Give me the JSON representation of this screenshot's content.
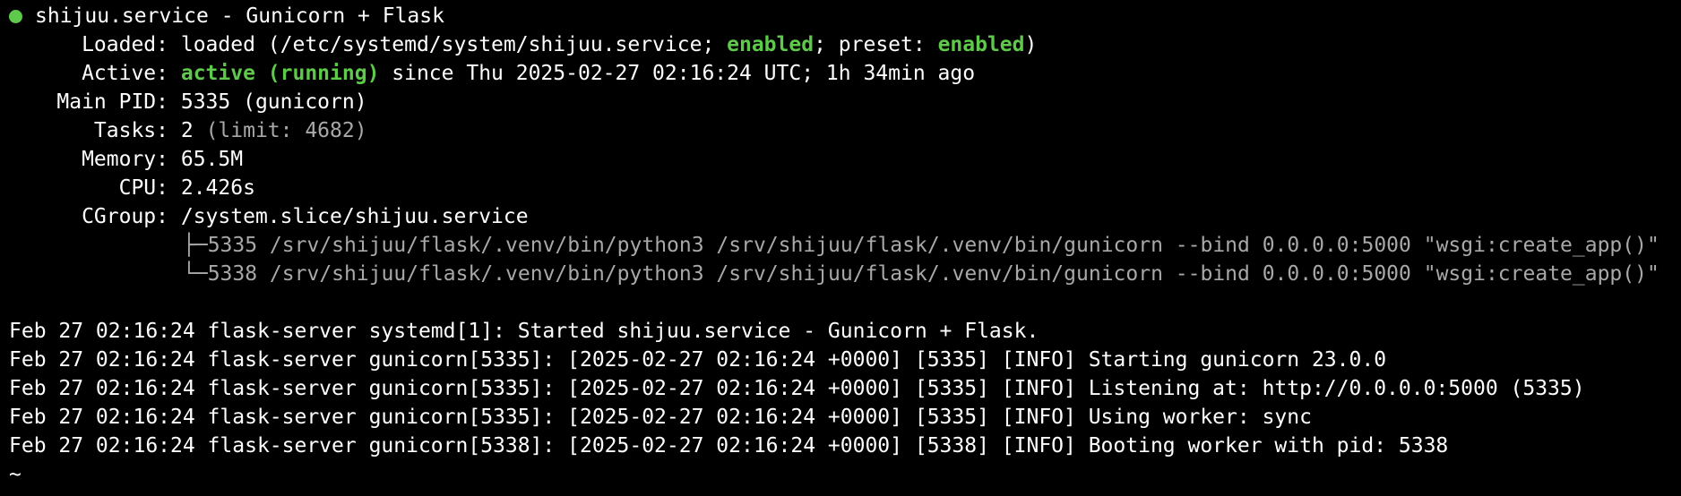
{
  "service": {
    "title": "shijuu.service - Gunicorn + Flask",
    "status_dot_color": "#5ec94a",
    "loaded": {
      "label": "Loaded:",
      "prefix": "loaded (/etc/systemd/system/shijuu.service; ",
      "enabled": "enabled",
      "middle": "; preset: ",
      "preset": "enabled",
      "suffix": ")"
    },
    "active": {
      "label": "Active:",
      "state": "active (running)",
      "since": " since Thu 2025-02-27 02:16:24 UTC; 1h 34min ago"
    },
    "main_pid": {
      "label": "Main PID:",
      "value": "5335 (gunicorn)"
    },
    "tasks": {
      "label": "Tasks:",
      "value": "2 ",
      "limit": "(limit: 4682)"
    },
    "memory": {
      "label": "Memory:",
      "value": "65.5M"
    },
    "cpu": {
      "label": "CPU:",
      "value": "2.426s"
    },
    "cgroup": {
      "label": "CGroup:",
      "value": "/system.slice/shijuu.service",
      "processes": [
        "├─5335 /srv/shijuu/flask/.venv/bin/python3 /srv/shijuu/flask/.venv/bin/gunicorn --bind 0.0.0.0:5000 \"wsgi:create_app()\"",
        "└─5338 /srv/shijuu/flask/.venv/bin/python3 /srv/shijuu/flask/.venv/bin/gunicorn --bind 0.0.0.0:5000 \"wsgi:create_app()\""
      ]
    }
  },
  "logs": [
    "Feb 27 02:16:24 flask-server systemd[1]: Started shijuu.service - Gunicorn + Flask.",
    "Feb 27 02:16:24 flask-server gunicorn[5335]: [2025-02-27 02:16:24 +0000] [5335] [INFO] Starting gunicorn 23.0.0",
    "Feb 27 02:16:24 flask-server gunicorn[5335]: [2025-02-27 02:16:24 +0000] [5335] [INFO] Listening at: http://0.0.0.0:5000 (5335)",
    "Feb 27 02:16:24 flask-server gunicorn[5335]: [2025-02-27 02:16:24 +0000] [5335] [INFO] Using worker: sync",
    "Feb 27 02:16:24 flask-server gunicorn[5338]: [2025-02-27 02:16:24 +0000] [5338] [INFO] Booting worker with pid: 5338"
  ],
  "prompt": {
    "tilde": "~"
  }
}
